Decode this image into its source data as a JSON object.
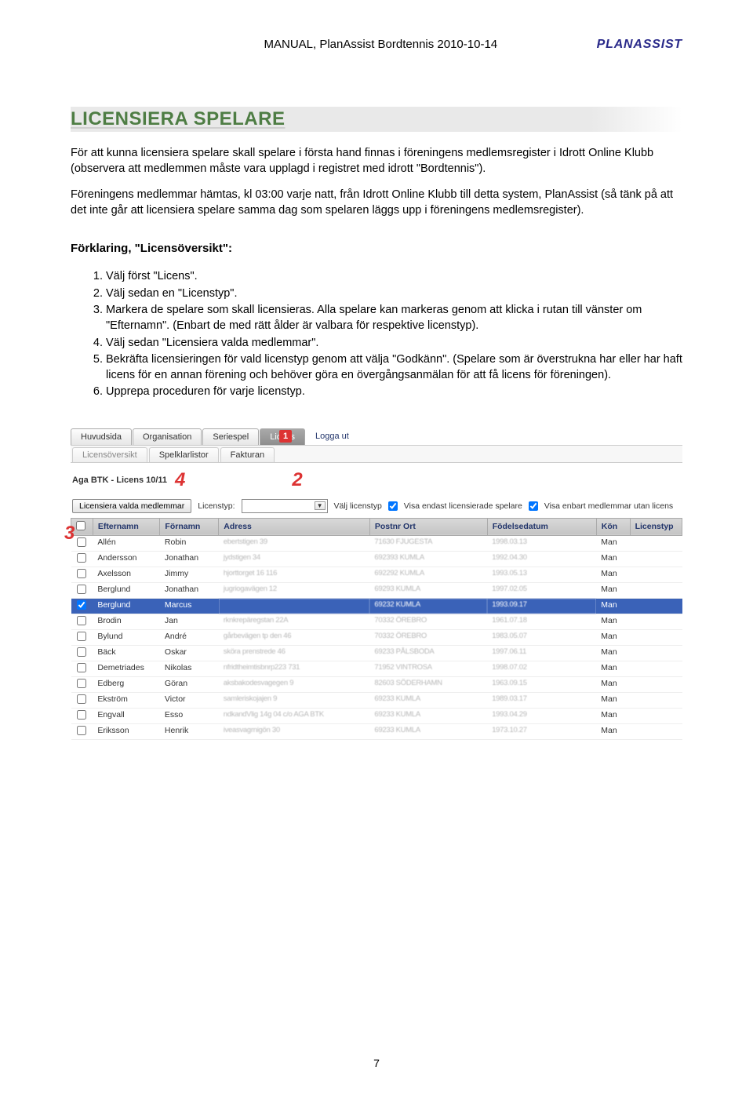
{
  "header": {
    "doc_title": "MANUAL, PlanAssist Bordtennis 2010-10-14",
    "brand": "PLANASSIST"
  },
  "page_title": "LICENSIERA SPELARE",
  "para1": "För att kunna licensiera spelare skall spelare i första hand finnas i föreningens medlemsregister i Idrott Online Klubb (observera att medlemmen måste vara upplagd i registret med idrott \"Bordtennis\").",
  "para2": "Föreningens medlemmar hämtas, kl 03:00 varje natt, från Idrott Online Klubb till detta system, PlanAssist (så tänk på att det inte går att licensiera spelare samma dag som spelaren läggs upp i föreningens medlemsregister).",
  "subhead": "Förklaring, \"Licensöversikt\":",
  "steps": [
    "Välj först \"Licens\".",
    "Välj sedan en \"Licenstyp\".",
    "Markera de spelare som skall licensieras. Alla spelare kan markeras genom att klicka i rutan till vänster om \"Efternamn\". (Enbart de med rätt ålder är valbara för respektive licenstyp).",
    "Välj sedan \"Licensiera valda medlemmar\".",
    "Bekräfta licensieringen för vald licenstyp genom att välja \"Godkänn\". (Spelare som är överstrukna har eller har haft licens för en annan förening och behöver göra en övergångsanmälan för att få licens för föreningen).",
    "Upprepa proceduren för varje licenstyp."
  ],
  "app": {
    "tabs": [
      "Huvudsida",
      "Organisation",
      "Seriespel",
      "Licens",
      "Logga ut"
    ],
    "active_tab": "Licens",
    "subtabs": [
      "Licensöversikt",
      "Spelklarlistor",
      "Fakturan"
    ],
    "pageheader": "Aga BTK - Licens 10/11",
    "toolbar": {
      "btn_licensiera": "Licensiera valda medlemmar",
      "label_licenstyp": "Licenstyp:",
      "label_valj": "Välj licenstyp",
      "chk1": "Visa endast licensierade spelare",
      "chk2": "Visa enbart medlemmar utan licens"
    },
    "columns": [
      "",
      "Efternamn",
      "Förnamn",
      "Adress",
      "Postnr Ort",
      "Födelsedatum",
      "Kön",
      "Licenstyp"
    ],
    "rows": [
      {
        "chk": false,
        "eft": "Allén",
        "for": "Robin",
        "adr": "ebertstigen 39",
        "pst": "71630 FJUGESTA",
        "fod": "1998.03.13",
        "kon": "Man",
        "lic": "",
        "sel": false
      },
      {
        "chk": false,
        "eft": "Andersson",
        "for": "Jonathan",
        "adr": "jydstigen 34",
        "pst": "692393 KUMLA",
        "fod": "1992.04.30",
        "kon": "Man",
        "lic": "",
        "sel": false
      },
      {
        "chk": false,
        "eft": "Axelsson",
        "for": "Jimmy",
        "adr": "hjorttorget 16 116",
        "pst": "692292 KUMLA",
        "fod": "1993.05.13",
        "kon": "Man",
        "lic": "",
        "sel": false
      },
      {
        "chk": false,
        "eft": "Berglund",
        "for": "Jonathan",
        "adr": "jugriogavägen 12",
        "pst": "69293 KUMLA",
        "fod": "1997.02.05",
        "kon": "Man",
        "lic": "",
        "sel": false
      },
      {
        "chk": true,
        "eft": "Berglund",
        "for": "Marcus",
        "adr": "",
        "pst": "69232 KUMLA",
        "fod": "1993.09.17",
        "kon": "Man",
        "lic": "",
        "sel": true
      },
      {
        "chk": false,
        "eft": "Brodin",
        "for": "Jan",
        "adr": "rknkrepäregstan 22A",
        "pst": "70332 ÖREBRO",
        "fod": "1961.07.18",
        "kon": "Man",
        "lic": "",
        "sel": false
      },
      {
        "chk": false,
        "eft": "Bylund",
        "for": "André",
        "adr": "gårbevägen tp den 46",
        "pst": "70332 ÖREBRO",
        "fod": "1983.05.07",
        "kon": "Man",
        "lic": "",
        "sel": false
      },
      {
        "chk": false,
        "eft": "Bäck",
        "for": "Oskar",
        "adr": "sköra prenstrede 46",
        "pst": "69233 PÅLSBODA",
        "fod": "1997.06.11",
        "kon": "Man",
        "lic": "",
        "sel": false
      },
      {
        "chk": false,
        "eft": "Demetriades",
        "for": "Nikolas",
        "adr": "nfridtheimtisbnrp223 731",
        "pst": "71952 VINTROSA",
        "fod": "1998.07.02",
        "kon": "Man",
        "lic": "",
        "sel": false
      },
      {
        "chk": false,
        "eft": "Edberg",
        "for": "Göran",
        "adr": "aksbakodesvagegen 9",
        "pst": "82603 SÖDERHAMN",
        "fod": "1963.09.15",
        "kon": "Man",
        "lic": "",
        "sel": false
      },
      {
        "chk": false,
        "eft": "Ekström",
        "for": "Victor",
        "adr": "samleriskojajen 9",
        "pst": "69233 KUMLA",
        "fod": "1989.03.17",
        "kon": "Man",
        "lic": "",
        "sel": false
      },
      {
        "chk": false,
        "eft": "Engvall",
        "for": "Esso",
        "adr": "ndkandVlig 14g 04 c/o AGA BTK",
        "pst": "69233 KUMLA",
        "fod": "1993.04.29",
        "kon": "Man",
        "lic": "",
        "sel": false
      },
      {
        "chk": false,
        "eft": "Eriksson",
        "for": "Henrik",
        "adr": "iveasvagrnigön 30",
        "pst": "69233 KUMLA",
        "fod": "1973.10.27",
        "kon": "Man",
        "lic": "",
        "sel": false
      }
    ],
    "annotations": {
      "a1": "1",
      "a2": "2",
      "a3": "3",
      "a4": "4"
    }
  },
  "pagenum": "7"
}
